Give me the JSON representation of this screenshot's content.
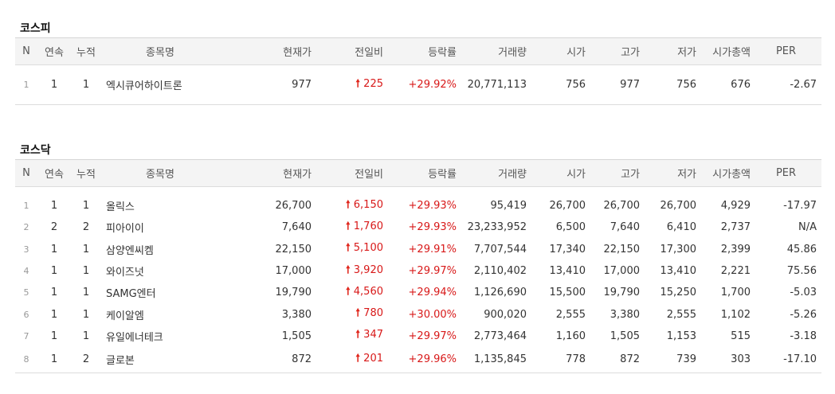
{
  "columns": [
    "N",
    "연속",
    "누적",
    "종목명",
    "현재가",
    "전일비",
    "등락률",
    "거래량",
    "시가",
    "고가",
    "저가",
    "시가총액",
    "PER"
  ],
  "kospi": {
    "title": "코스피",
    "rows": [
      {
        "n": "1",
        "streak": "1",
        "cum": "1",
        "name": "엑시큐어하이트론",
        "price": "977",
        "change": "225",
        "rate": "+29.92%",
        "volume": "20,771,113",
        "open": "756",
        "high": "977",
        "low": "756",
        "mcap": "676",
        "per": "-2.67"
      }
    ]
  },
  "kosdaq": {
    "title": "코스닥",
    "rows": [
      {
        "n": "1",
        "streak": "1",
        "cum": "1",
        "name": "올릭스",
        "price": "26,700",
        "change": "6,150",
        "rate": "+29.93%",
        "volume": "95,419",
        "open": "26,700",
        "high": "26,700",
        "low": "26,700",
        "mcap": "4,929",
        "per": "-17.97"
      },
      {
        "n": "2",
        "streak": "2",
        "cum": "2",
        "name": "피아이이",
        "price": "7,640",
        "change": "1,760",
        "rate": "+29.93%",
        "volume": "23,233,952",
        "open": "6,500",
        "high": "7,640",
        "low": "6,410",
        "mcap": "2,737",
        "per": "N/A"
      },
      {
        "n": "3",
        "streak": "1",
        "cum": "1",
        "name": "삼양엔씨켐",
        "price": "22,150",
        "change": "5,100",
        "rate": "+29.91%",
        "volume": "7,707,544",
        "open": "17,340",
        "high": "22,150",
        "low": "17,300",
        "mcap": "2,399",
        "per": "45.86"
      },
      {
        "n": "4",
        "streak": "1",
        "cum": "1",
        "name": "와이즈넛",
        "price": "17,000",
        "change": "3,920",
        "rate": "+29.97%",
        "volume": "2,110,402",
        "open": "13,410",
        "high": "17,000",
        "low": "13,410",
        "mcap": "2,221",
        "per": "75.56"
      },
      {
        "n": "5",
        "streak": "1",
        "cum": "1",
        "name": "SAMG엔터",
        "price": "19,790",
        "change": "4,560",
        "rate": "+29.94%",
        "volume": "1,126,690",
        "open": "15,500",
        "high": "19,790",
        "low": "15,250",
        "mcap": "1,700",
        "per": "-5.03"
      },
      {
        "n": "6",
        "streak": "1",
        "cum": "1",
        "name": "케이알엠",
        "price": "3,380",
        "change": "780",
        "rate": "+30.00%",
        "volume": "900,020",
        "open": "2,555",
        "high": "3,380",
        "low": "2,555",
        "mcap": "1,102",
        "per": "-5.26"
      },
      {
        "n": "7",
        "streak": "1",
        "cum": "1",
        "name": "유일에너테크",
        "price": "1,505",
        "change": "347",
        "rate": "+29.97%",
        "volume": "2,773,464",
        "open": "1,160",
        "high": "1,505",
        "low": "1,153",
        "mcap": "515",
        "per": "-3.18"
      },
      {
        "n": "8",
        "streak": "1",
        "cum": "2",
        "name": "글로본",
        "price": "872",
        "change": "201",
        "rate": "+29.96%",
        "volume": "1,135,845",
        "open": "778",
        "high": "872",
        "low": "739",
        "mcap": "303",
        "per": "-17.10"
      }
    ]
  },
  "colors": {
    "up": "#d81818",
    "arrow": "#e0261c",
    "header_bg": "#f4f4f4"
  },
  "icons": {
    "up": "up-arrow-icon"
  }
}
